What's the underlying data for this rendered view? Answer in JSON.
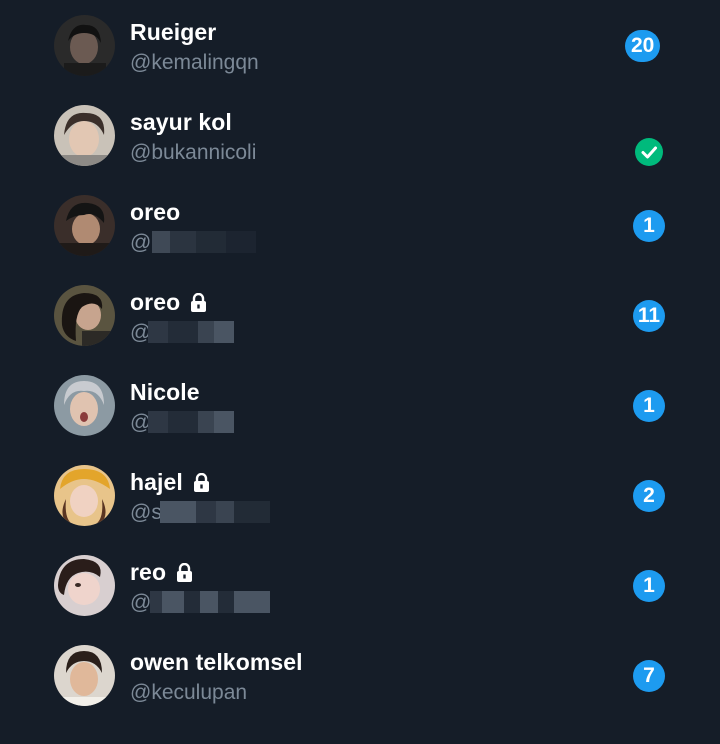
{
  "contacts": [
    {
      "name": "Rueiger",
      "handle": "@kemalingqn",
      "locked": false,
      "badge": "20",
      "badge_type": "count",
      "avatar_icon": "avatar-photo"
    },
    {
      "name": "sayur kol",
      "handle": "@bukannicoli",
      "locked": false,
      "badge": "",
      "badge_type": "check",
      "avatar_icon": "avatar-photo"
    },
    {
      "name": "oreo",
      "handle": "@s",
      "locked": false,
      "badge": "1",
      "badge_type": "count",
      "avatar_icon": "avatar-photo"
    },
    {
      "name": "oreo",
      "handle": "@",
      "locked": true,
      "badge": "11",
      "badge_type": "count",
      "avatar_icon": "avatar-photo"
    },
    {
      "name": "Nicole",
      "handle": "@",
      "locked": false,
      "badge": "1",
      "badge_type": "count",
      "avatar_icon": "avatar-photo"
    },
    {
      "name": "hajel",
      "handle": "@s",
      "locked": true,
      "badge": "2",
      "badge_type": "count",
      "avatar_icon": "avatar-photo"
    },
    {
      "name": "reo",
      "handle": "@",
      "locked": true,
      "badge": "1",
      "badge_type": "count",
      "avatar_icon": "avatar-photo"
    },
    {
      "name": "owen telkomsel",
      "handle": "@keculupan",
      "locked": false,
      "badge": "7",
      "badge_type": "count",
      "avatar_icon": "avatar-photo"
    }
  ],
  "colors": {
    "background": "#151d28",
    "badge_blue": "#1d9bf0",
    "check_green": "#00ba7c",
    "handle_gray": "#7c8997"
  },
  "icons": {
    "lock": "lock-icon",
    "check": "check-circle-icon"
  }
}
